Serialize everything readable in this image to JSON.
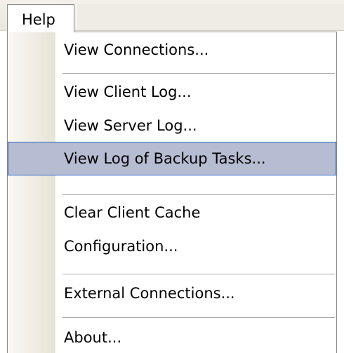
{
  "menubar": {
    "active_menu_label": "Help"
  },
  "menu": {
    "items": [
      {
        "label": "View Connections...",
        "selected": false
      },
      {
        "label": "View Client Log...",
        "selected": false
      },
      {
        "label": "View Server Log...",
        "selected": false
      },
      {
        "label": "View Log of Backup Tasks...",
        "selected": true
      },
      {
        "label": "Clear Client Cache",
        "selected": false
      },
      {
        "label": "Configuration...",
        "selected": false
      },
      {
        "label": "External Connections...",
        "selected": false
      },
      {
        "label": "About...",
        "selected": false
      }
    ]
  },
  "colors": {
    "highlight_fill": "#b6bdd2",
    "highlight_border": "#316ac5",
    "separator": "#a7a6aa",
    "gutter": "#e7e3d7"
  }
}
